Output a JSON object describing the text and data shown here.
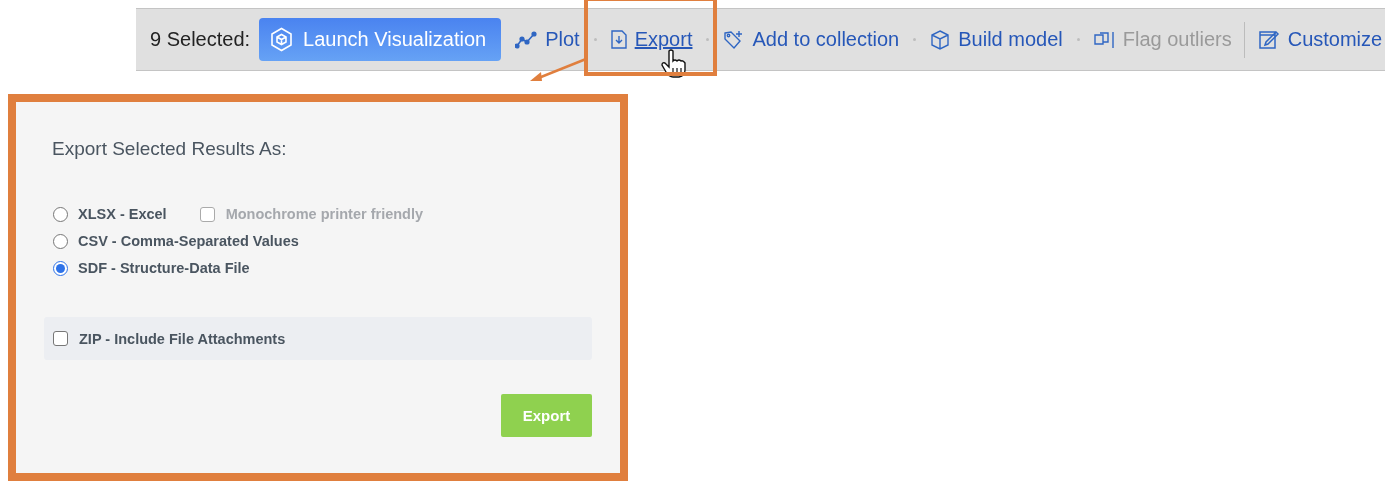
{
  "toolbar": {
    "items": [
      {
        "kind": "label",
        "text": "9 Selected:"
      },
      {
        "kind": "primary",
        "text": "Launch Visualization"
      },
      {
        "kind": "action",
        "text": "Plot",
        "disabled": false,
        "hovered": false,
        "highlighted": false
      },
      {
        "kind": "action",
        "text": "Export",
        "disabled": false,
        "hovered": true,
        "highlighted": true
      },
      {
        "kind": "action",
        "text": "Add to collection",
        "disabled": false,
        "hovered": false,
        "highlighted": false
      },
      {
        "kind": "action",
        "text": "Build model",
        "disabled": false,
        "hovered": false,
        "highlighted": false
      },
      {
        "kind": "action",
        "text": "Flag outliers",
        "disabled": true,
        "hovered": false,
        "highlighted": false
      },
      {
        "kind": "divider"
      },
      {
        "kind": "action",
        "text": "Customize",
        "disabled": false,
        "hovered": false,
        "highlighted": false
      }
    ]
  },
  "export_panel": {
    "title": "Export Selected Results As:",
    "formats": [
      {
        "label": "XLSX - Excel",
        "selected": false
      },
      {
        "label": "CSV - Comma-Separated Values",
        "selected": false
      },
      {
        "label": "SDF - Structure-Data File",
        "selected": true
      }
    ],
    "monochrome_option": {
      "label": "Monochrome printer friendly",
      "checked": false,
      "disabled": true
    },
    "zip_option": {
      "label": "ZIP - Include File Attachments",
      "checked": false
    },
    "button": "Export"
  }
}
